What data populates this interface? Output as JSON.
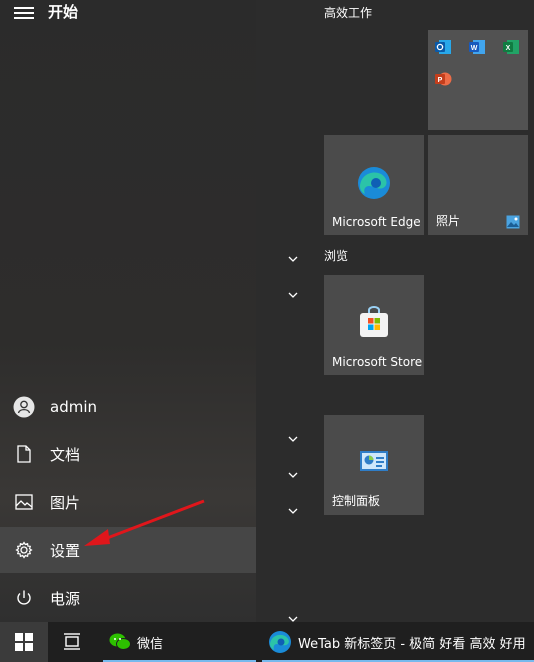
{
  "header": {
    "title": "开始"
  },
  "left_menu": {
    "user": "admin",
    "items": [
      {
        "label": "文档",
        "icon": "document-icon"
      },
      {
        "label": "图片",
        "icon": "picture-icon"
      },
      {
        "label": "设置",
        "icon": "gear-icon"
      },
      {
        "label": "电源",
        "icon": "power-icon"
      }
    ]
  },
  "groups": {
    "productivity": "高效工作",
    "browse": "浏览"
  },
  "tiles": {
    "edge": "Microsoft Edge",
    "photos": "照片",
    "store": "Microsoft Store",
    "control_panel": "控制面板"
  },
  "office_icons": [
    "outlook-icon",
    "word-icon",
    "excel-icon",
    "powerpoint-icon"
  ],
  "taskbar": {
    "wechat": "微信",
    "browser": "WeTab 新标签页 - 极简 好看 高效 好用"
  },
  "colors": {
    "accent": "#76b9ed",
    "active_item_bg": "#464646",
    "tile_bg": "#4b4b4b",
    "arrow": "#e0161b"
  }
}
